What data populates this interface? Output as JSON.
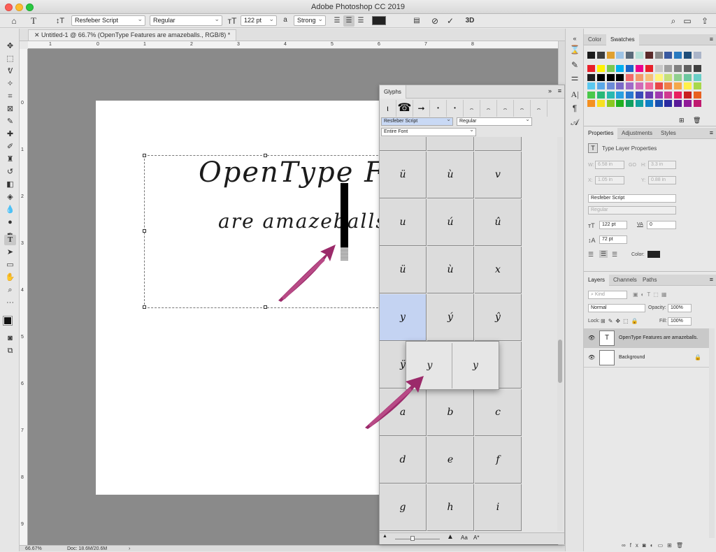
{
  "app": {
    "title": "Adobe Photoshop CC 2019"
  },
  "options": {
    "font_family": "Resfeber Script",
    "font_style": "Regular",
    "font_size": "122 pt",
    "aa_label": "a",
    "aa": "Strong",
    "threed": "3D"
  },
  "document": {
    "tab": "Untitled-1 @ 66.7% (OpenType Features are amazeballs., RGB/8) *",
    "line1": "OpenType Features",
    "line2": "are amazeballs.",
    "zoom": "66.67%",
    "doc_size": "Doc: 18.6M/20.6M"
  },
  "ruler": {
    "h": [
      "1",
      "0",
      "1",
      "2",
      "3",
      "4",
      "5",
      "6",
      "7",
      "8"
    ],
    "v": [
      "0",
      "1",
      "2",
      "3",
      "4",
      "5",
      "6",
      "7",
      "8",
      "9"
    ]
  },
  "glyphs": {
    "title": "Glyphs",
    "font": "Resfeber Script",
    "style": "Regular",
    "show": "Entire Font",
    "recent": [
      "ι",
      "☎",
      "➞",
      "•",
      "•",
      "⌢",
      "⌢",
      "⌢",
      "⌢",
      "⌢"
    ],
    "cells": [
      [
        "ü",
        "ù",
        "v"
      ],
      [
        "u",
        "ú",
        "û"
      ],
      [
        "ü",
        "ù",
        "x"
      ],
      [
        "y",
        "ý",
        "ŷ"
      ],
      [
        "ÿ",
        "",
        ""
      ],
      [
        "a",
        "b",
        "c"
      ],
      [
        "d",
        "e",
        "f"
      ],
      [
        "g",
        "h",
        "i"
      ]
    ],
    "alternates": [
      "y",
      "y"
    ]
  },
  "color_panel": {
    "tabs": [
      "Color",
      "Swatches"
    ]
  },
  "swatches": {
    "row1": [
      "#1a1a1a",
      "#3c3c3c",
      "#e0a030",
      "#9dc3e6",
      "#5a6a7a",
      "#b8e0d8",
      "#5a2a2a",
      "#8a8a8a",
      "#3a5aa0",
      "#2a7ac0",
      "#1f4e79",
      "#aab4c8"
    ],
    "rows": [
      [
        "#e8202a",
        "#fff200",
        "#78c850",
        "#00aeef",
        "#1a64c8",
        "#ec008c",
        "#e8202a",
        "#c8c8c8",
        "#a0a0a0",
        "#808080",
        "#606060",
        "#404040"
      ],
      [
        "#202020",
        "#000000",
        "#000000",
        "#000000",
        "#f26a6a",
        "#f49a6a",
        "#f6c078",
        "#fff57a",
        "#c4e07a",
        "#90d090",
        "#6cc8a0",
        "#6ad0c8"
      ],
      [
        "#5ac8f0",
        "#5aa8e8",
        "#6a8ad8",
        "#7a6ac8",
        "#a06ac8",
        "#d06ab8",
        "#f06a9a",
        "#e84848",
        "#f08048",
        "#f4a84a",
        "#fff04a",
        "#a8d84a"
      ],
      [
        "#4ac84a",
        "#2ab878",
        "#2ab8b0",
        "#2aa0e0",
        "#2a78d0",
        "#3a4ab8",
        "#6a3ab0",
        "#a03ab0",
        "#d03a90",
        "#e82060",
        "#c82020",
        "#e86020"
      ],
      [
        "#f49020",
        "#f8e020",
        "#8ac820",
        "#20b020",
        "#10a060",
        "#10a0a0",
        "#1080c8",
        "#1a50b0",
        "#2a2aa0",
        "#5a1a98",
        "#901a98",
        "#c01a70"
      ]
    ]
  },
  "properties": {
    "tabs": [
      "Properties",
      "Adjustments",
      "Styles"
    ],
    "type_label": "Type Layer Properties",
    "w_label": "W:",
    "w": "6.58 in",
    "link": "GO",
    "h_label": "H:",
    "h": "3.3 in",
    "x_label": "X:",
    "x": "1.05 in",
    "y_label": "Y:",
    "y": "0.88 in",
    "font": "Resfeber Script",
    "style": "Regular",
    "size": "122 pt",
    "tracking_label": "VA",
    "tracking": "0",
    "leading": "72 pt",
    "color_label": "Color:"
  },
  "layers": {
    "tabs": [
      "Layers",
      "Channels",
      "Paths"
    ],
    "kind": "Kind",
    "blend": "Normal",
    "opacity_label": "Opacity:",
    "opacity": "100%",
    "lock_label": "Lock:",
    "fill_label": "Fill:",
    "fill": "100%",
    "items": [
      {
        "name": "OpenType Features are amazeballs.",
        "thumb": "T"
      },
      {
        "name": "Background",
        "thumb": ""
      }
    ]
  },
  "accent": "#9b2a6a"
}
